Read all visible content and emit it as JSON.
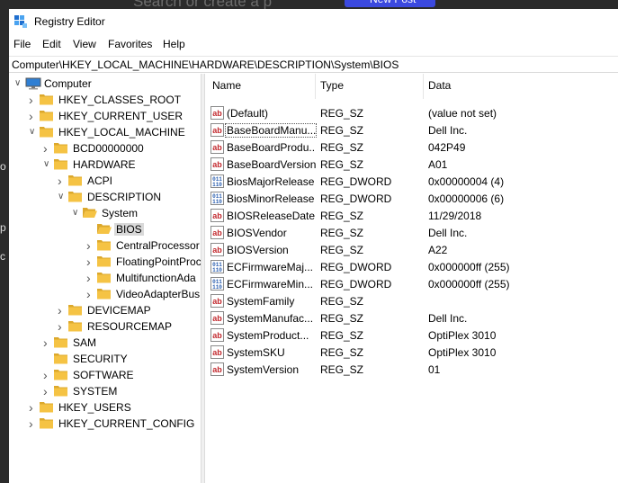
{
  "background": {
    "search_text": "Search or create a p",
    "button_label": "New Post",
    "left_glyphs": [
      "o",
      "p",
      "c"
    ]
  },
  "window": {
    "title": "Registry Editor"
  },
  "menu": [
    "File",
    "Edit",
    "View",
    "Favorites",
    "Help"
  ],
  "address": "Computer\\HKEY_LOCAL_MACHINE\\HARDWARE\\DESCRIPTION\\System\\BIOS",
  "tree": [
    {
      "label": "Computer",
      "level": 0,
      "expander": "down",
      "icon": "computer-icon"
    },
    {
      "label": "HKEY_CLASSES_ROOT",
      "level": 1,
      "expander": "right",
      "icon": "folder-icon"
    },
    {
      "label": "HKEY_CURRENT_USER",
      "level": 1,
      "expander": "right",
      "icon": "folder-icon"
    },
    {
      "label": "HKEY_LOCAL_MACHINE",
      "level": 1,
      "expander": "down",
      "icon": "folder-icon"
    },
    {
      "label": "BCD00000000",
      "level": 2,
      "expander": "right",
      "icon": "folder-icon"
    },
    {
      "label": "HARDWARE",
      "level": 2,
      "expander": "down",
      "icon": "folder-icon"
    },
    {
      "label": "ACPI",
      "level": 3,
      "expander": "right",
      "icon": "folder-icon"
    },
    {
      "label": "DESCRIPTION",
      "level": 3,
      "expander": "down",
      "icon": "folder-icon"
    },
    {
      "label": "System",
      "level": 4,
      "expander": "down",
      "icon": "folder-open-icon"
    },
    {
      "label": "BIOS",
      "level": 5,
      "expander": "none",
      "icon": "folder-open-icon",
      "selected": true
    },
    {
      "label": "CentralProcessor",
      "level": 5,
      "expander": "right",
      "icon": "folder-icon"
    },
    {
      "label": "FloatingPointProc",
      "level": 5,
      "expander": "right",
      "icon": "folder-icon"
    },
    {
      "label": "MultifunctionAda",
      "level": 5,
      "expander": "right",
      "icon": "folder-icon"
    },
    {
      "label": "VideoAdapterBus",
      "level": 5,
      "expander": "right",
      "icon": "folder-icon"
    },
    {
      "label": "DEVICEMAP",
      "level": 3,
      "expander": "right",
      "icon": "folder-icon"
    },
    {
      "label": "RESOURCEMAP",
      "level": 3,
      "expander": "right",
      "icon": "folder-icon"
    },
    {
      "label": "SAM",
      "level": 2,
      "expander": "right",
      "icon": "folder-icon"
    },
    {
      "label": "SECURITY",
      "level": 2,
      "expander": "none",
      "icon": "folder-icon"
    },
    {
      "label": "SOFTWARE",
      "level": 2,
      "expander": "right",
      "icon": "folder-icon"
    },
    {
      "label": "SYSTEM",
      "level": 2,
      "expander": "right",
      "icon": "folder-icon"
    },
    {
      "label": "HKEY_USERS",
      "level": 1,
      "expander": "right",
      "icon": "folder-icon"
    },
    {
      "label": "HKEY_CURRENT_CONFIG",
      "level": 1,
      "expander": "right",
      "icon": "folder-icon"
    }
  ],
  "columns": {
    "name": "Name",
    "type": "Type",
    "data": "Data"
  },
  "values": [
    {
      "name": "(Default)",
      "type": "REG_SZ",
      "data": "(value not set)",
      "icon": "string-value-icon"
    },
    {
      "name": "BaseBoardManu...",
      "type": "REG_SZ",
      "data": "Dell Inc.",
      "icon": "string-value-icon",
      "focused": true
    },
    {
      "name": "BaseBoardProdu...",
      "type": "REG_SZ",
      "data": "042P49",
      "icon": "string-value-icon"
    },
    {
      "name": "BaseBoardVersion",
      "type": "REG_SZ",
      "data": "A01",
      "icon": "string-value-icon"
    },
    {
      "name": "BiosMajorRelease",
      "type": "REG_DWORD",
      "data": "0x00000004 (4)",
      "icon": "binary-value-icon"
    },
    {
      "name": "BiosMinorRelease",
      "type": "REG_DWORD",
      "data": "0x00000006 (6)",
      "icon": "binary-value-icon"
    },
    {
      "name": "BIOSReleaseDate",
      "type": "REG_SZ",
      "data": "11/29/2018",
      "icon": "string-value-icon"
    },
    {
      "name": "BIOSVendor",
      "type": "REG_SZ",
      "data": "Dell Inc.",
      "icon": "string-value-icon"
    },
    {
      "name": "BIOSVersion",
      "type": "REG_SZ",
      "data": "A22",
      "icon": "string-value-icon"
    },
    {
      "name": "ECFirmwareMaj...",
      "type": "REG_DWORD",
      "data": "0x000000ff (255)",
      "icon": "binary-value-icon"
    },
    {
      "name": "ECFirmwareMin...",
      "type": "REG_DWORD",
      "data": "0x000000ff (255)",
      "icon": "binary-value-icon"
    },
    {
      "name": "SystemFamily",
      "type": "REG_SZ",
      "data": "",
      "icon": "string-value-icon"
    },
    {
      "name": "SystemManufac...",
      "type": "REG_SZ",
      "data": "Dell Inc.",
      "icon": "string-value-icon"
    },
    {
      "name": "SystemProduct...",
      "type": "REG_SZ",
      "data": "OptiPlex 3010",
      "icon": "string-value-icon"
    },
    {
      "name": "SystemSKU",
      "type": "REG_SZ",
      "data": "OptiPlex 3010",
      "icon": "string-value-icon"
    },
    {
      "name": "SystemVersion",
      "type": "REG_SZ",
      "data": "01",
      "icon": "string-value-icon"
    }
  ],
  "colors": {
    "folder": "#f5c344",
    "folder_dark": "#dca82c",
    "string_icon": "#c2282d",
    "binary_icon": "#2b5fb0",
    "selection": "#d9d9d9",
    "accent": "#3b49df"
  }
}
